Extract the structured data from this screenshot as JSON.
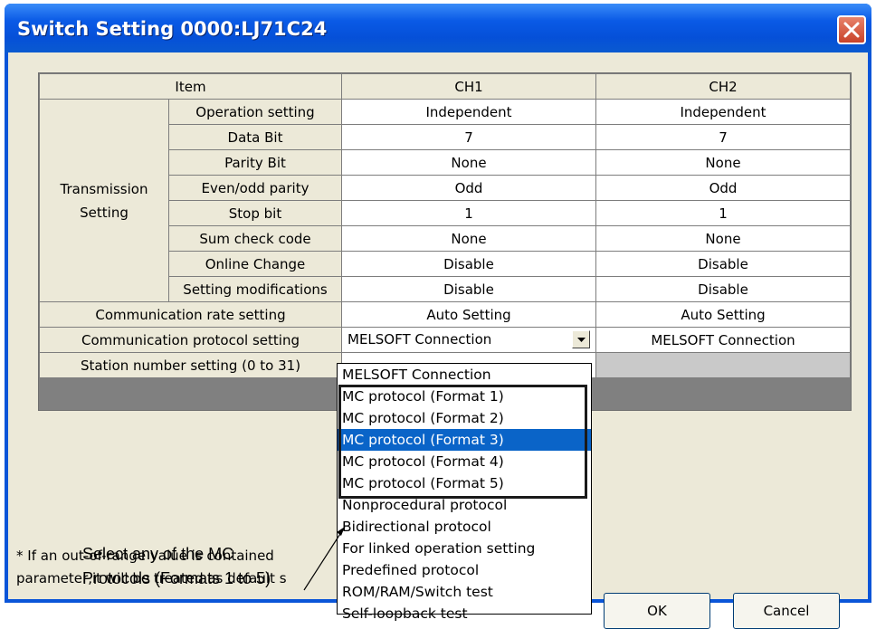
{
  "window": {
    "title": "Switch Setting 0000:LJ71C24"
  },
  "grid": {
    "header": {
      "item": "Item",
      "ch1": "CH1",
      "ch2": "CH2"
    },
    "transmission_group_label": "Transmission\nSetting",
    "transmission_rows": [
      {
        "label": "Operation setting",
        "ch1": "Independent",
        "ch2": "Independent"
      },
      {
        "label": "Data Bit",
        "ch1": "7",
        "ch2": "7"
      },
      {
        "label": "Parity Bit",
        "ch1": "None",
        "ch2": "None"
      },
      {
        "label": "Even/odd parity",
        "ch1": "Odd",
        "ch2": "Odd"
      },
      {
        "label": "Stop bit",
        "ch1": "1",
        "ch2": "1"
      },
      {
        "label": "Sum check code",
        "ch1": "None",
        "ch2": "None"
      },
      {
        "label": "Online Change",
        "ch1": "Disable",
        "ch2": "Disable"
      },
      {
        "label": "Setting modifications",
        "ch1": "Disable",
        "ch2": "Disable"
      }
    ],
    "comm_rate": {
      "label": "Communication rate setting",
      "ch1": "Auto Setting",
      "ch2": "Auto Setting"
    },
    "comm_protocol": {
      "label": "Communication protocol setting",
      "ch1": "MELSOFT Connection",
      "ch2": "MELSOFT Connection"
    },
    "station": {
      "label": "Station number setting (0 to 31)"
    }
  },
  "dropdown": {
    "options": [
      "MELSOFT Connection",
      "MC protocol (Format 1)",
      "MC protocol (Format 2)",
      "MC protocol (Format 3)",
      "MC protocol (Format 4)",
      "MC protocol (Format 5)",
      "Nonprocedural protocol",
      "Bidirectional protocol",
      "For linked operation setting",
      "Predefined protocol",
      "ROM/RAM/Switch test",
      "Self-loopback test"
    ],
    "highlighted_index": 3
  },
  "note": {
    "line1": "* If an out-of-range value is contained",
    "line2": "parameter,it will be treated as default s"
  },
  "buttons": {
    "ok": "OK",
    "cancel": "Cancel"
  },
  "callout": {
    "line1": "Select any of the MC",
    "line2": "Protocols (Formats 1 to 5)"
  },
  "colors": {
    "title_bar": "#0a55d8",
    "selection": "#0a64c8",
    "dialog_face": "#ece9d8",
    "close_button": "#c8422a"
  },
  "icons": {
    "close": "close-x-icon",
    "dropdown": "chevron-down-icon"
  }
}
